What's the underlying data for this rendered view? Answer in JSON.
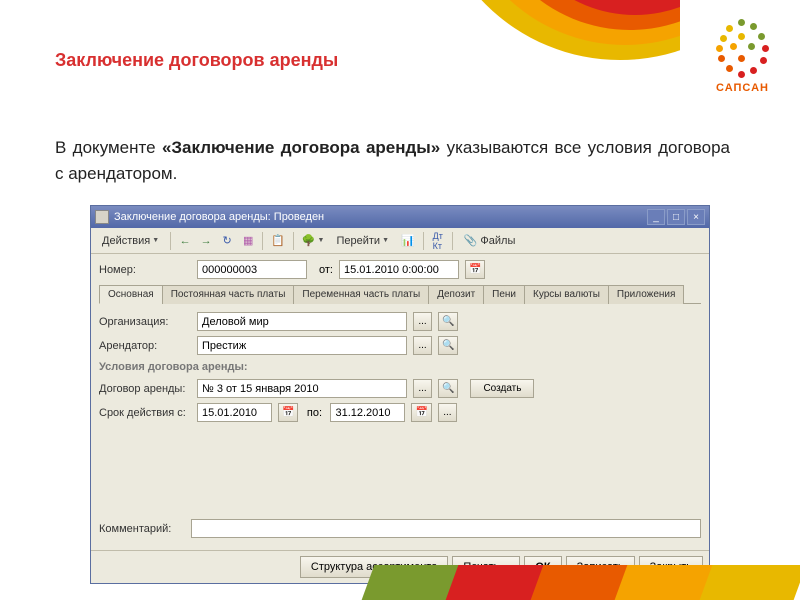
{
  "slide": {
    "heading": "Заключение договоров аренды",
    "body_prefix": "В документе ",
    "body_bold": "«Заключение договора аренды»",
    "body_suffix": " указываются все условия договора с арендатором.",
    "brand": "САПСАН"
  },
  "window": {
    "title": "Заключение договора аренды: Проведен",
    "minimize": "_",
    "maximize": "□",
    "close": "×"
  },
  "toolbar": {
    "actions": "Действия",
    "goto": "Перейти",
    "files": "Файлы"
  },
  "form": {
    "number_label": "Номер:",
    "number_value": "000000003",
    "from_label": "от:",
    "date_value": "15.01.2010 0:00:00",
    "org_label": "Организация:",
    "org_value": "Деловой мир",
    "tenant_label": "Арендатор:",
    "tenant_value": "Престиж",
    "section": "Условия договора аренды:",
    "contract_label": "Договор аренды:",
    "contract_value": "№ 3 от 15 января 2010",
    "create_btn": "Создать",
    "term_label": "Срок действия с:",
    "term_from": "15.01.2010",
    "term_to_label": "по:",
    "term_to": "31.12.2010",
    "comment_label": "Комментарий:",
    "comment_value": ""
  },
  "tabs": [
    "Основная",
    "Постоянная часть платы",
    "Переменная часть платы",
    "Депозит",
    "Пени",
    "Курсы валюты",
    "Приложения"
  ],
  "footer": {
    "struct": "Структура ассортимента",
    "print": "Печать",
    "ok": "ОК",
    "save": "Записать",
    "close": "Закрыть"
  }
}
